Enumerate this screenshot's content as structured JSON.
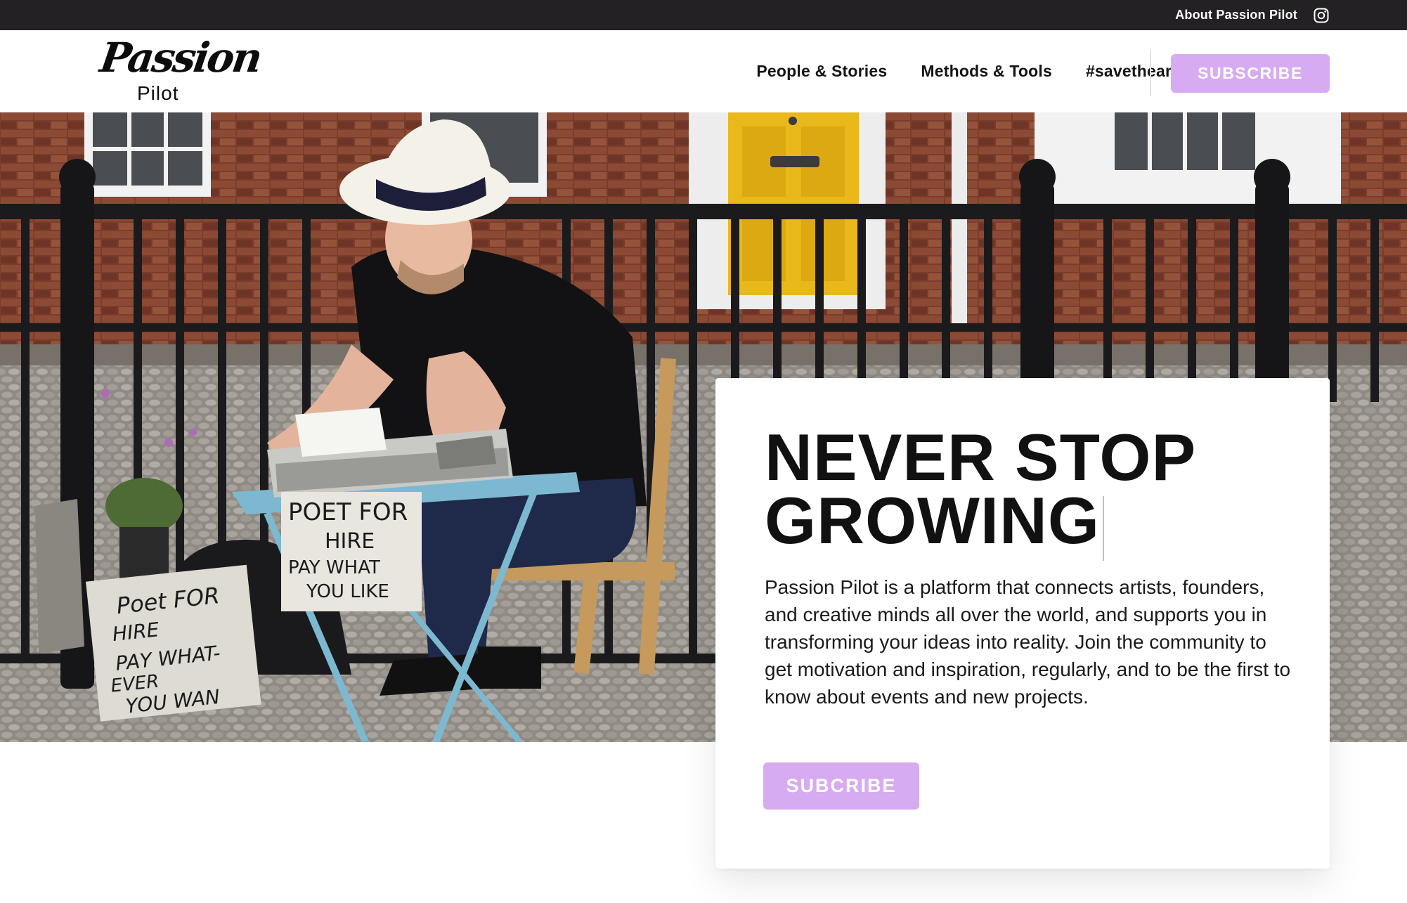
{
  "topbar": {
    "about_label": "About Passion Pilot",
    "instagram_icon": "instagram-icon"
  },
  "header": {
    "logo_script": "Passion",
    "logo_sub": "Pilot",
    "nav": [
      {
        "label": "People & Stories"
      },
      {
        "label": "Methods & Tools"
      },
      {
        "label": "#savethearts"
      }
    ],
    "subscribe_label": "SUBSCRIBE"
  },
  "hero": {
    "photo_subject": "street poet with typewriter",
    "sign_front": [
      "POET FOR",
      "HIRE",
      "PAY WHAT",
      "YOU LIKE"
    ],
    "sign_ground": [
      "Poet FOR",
      "HIRE",
      "PAY WHAT-",
      "EVER",
      "YOU WAN"
    ]
  },
  "card": {
    "headline_line1": "NEVER STOP",
    "headline_line2": "GROWING",
    "body": "Passion Pilot is a platform that connects artists, founders, and creative minds all over the world, and supports you in transforming your ideas into reality. Join the community to get motivation and inspiration, regularly, and to be the first to know about events and new projects.",
    "button_label": "SUBCRIBE"
  },
  "colors": {
    "topbar_bg": "#232123",
    "accent": "#d7abf1",
    "text": "#111111"
  }
}
